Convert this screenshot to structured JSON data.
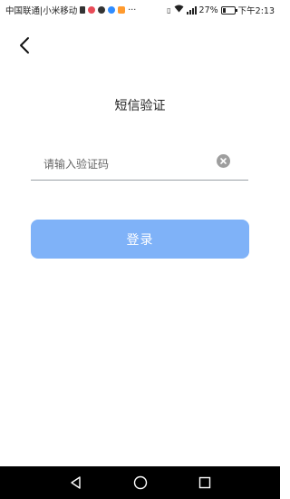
{
  "status_bar": {
    "carrier": "中国联通|小米移动",
    "battery": "27%",
    "time": "下午2:13"
  },
  "page": {
    "title": "短信验证"
  },
  "code_input": {
    "value": "",
    "placeholder": "请输入验证码"
  },
  "login_button": {
    "label": "登录"
  },
  "colors": {
    "primary_button": "#7fb2f8",
    "nav_bar": "#000000"
  }
}
